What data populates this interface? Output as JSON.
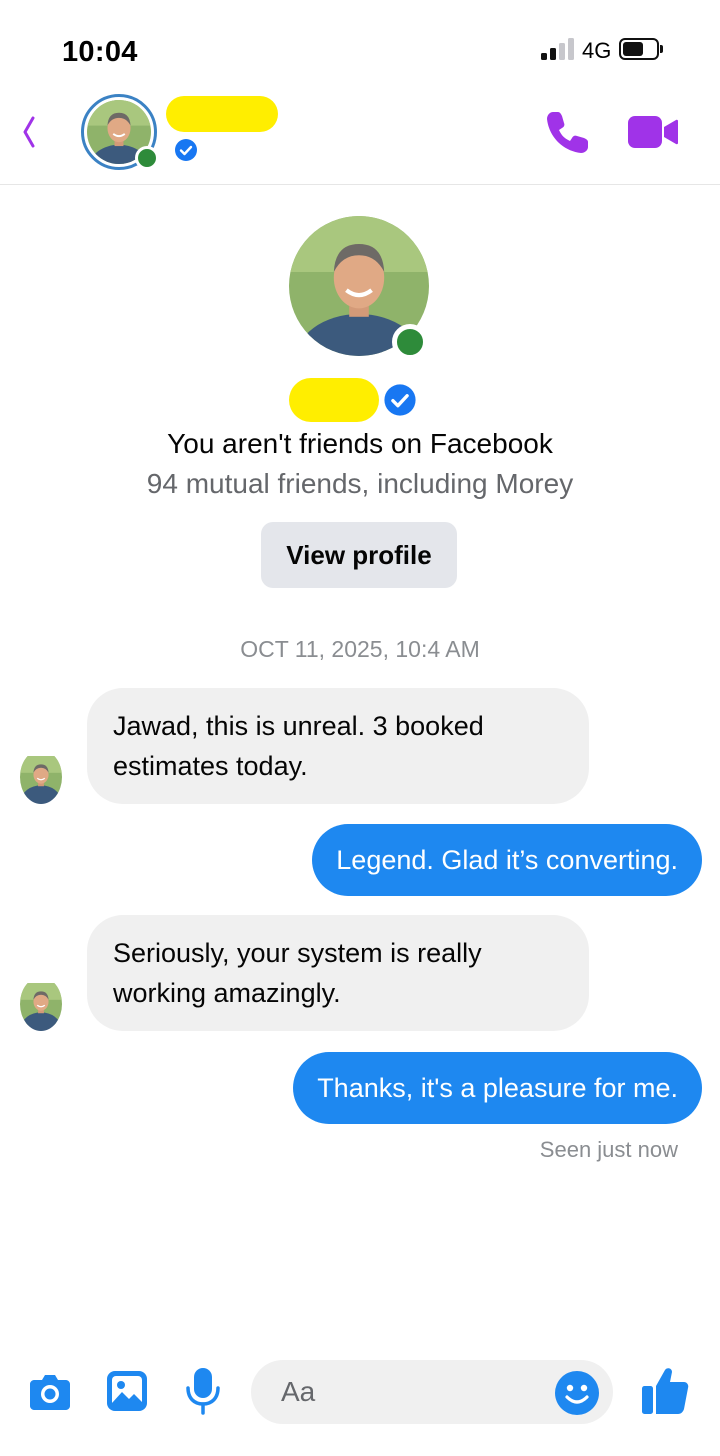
{
  "status_bar": {
    "time": "10:04",
    "network": "4G"
  },
  "header": {
    "contact_name_redacted": true,
    "verified": true,
    "online": true,
    "accent_color": "#a033e8"
  },
  "profile": {
    "friend_status": "You aren't friends on Facebook",
    "mutual_friends": "94 mutual friends, including Morey",
    "view_profile_label": "View profile"
  },
  "conversation": {
    "timestamp": "OCT 11, 2025, 10:4 AM",
    "messages": [
      {
        "from": "contact",
        "lines": [
          "Jawad, this is unreal. 3 booked",
          "estimates today."
        ]
      },
      {
        "from": "me",
        "text": "Legend. Glad it’s converting."
      },
      {
        "from": "contact",
        "lines": [
          "Seriously, your system is really",
          "working amazingly."
        ]
      },
      {
        "from": "me",
        "text": "Thanks, it's a pleasure for me."
      }
    ],
    "seen": "Seen just now"
  },
  "composer": {
    "placeholder": "Aa",
    "icons": [
      "camera-icon",
      "gallery-icon",
      "microphone-icon",
      "emoji-icon",
      "thumbs-up-icon"
    ],
    "accent_color": "#1e88f0"
  }
}
